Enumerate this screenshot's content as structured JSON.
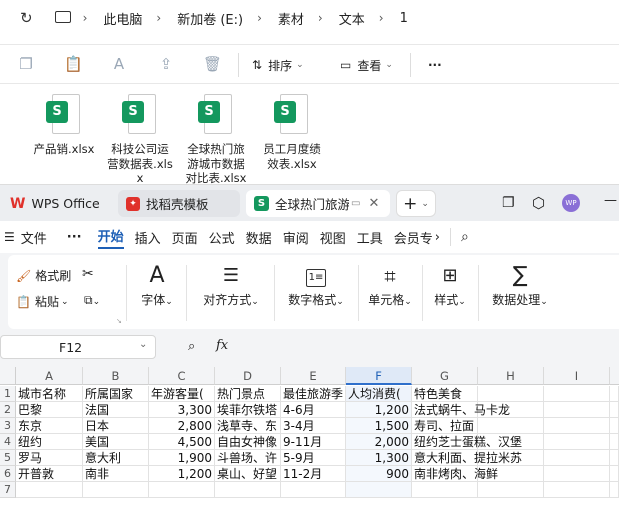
{
  "explorer": {
    "breadcrumb": [
      "此电脑",
      "新加卷 (E:)",
      "素材",
      "文本",
      "1"
    ],
    "toolbar": {
      "sort_label": "排序",
      "view_label": "查看",
      "more_label": "···"
    },
    "files": [
      {
        "name": "产品销.xlsx"
      },
      {
        "name": "科技公司运营数据表.xlsx"
      },
      {
        "name": "全球热门旅游城市数据对比表.xlsx"
      },
      {
        "name": "员工月度绩效表.xlsx"
      }
    ]
  },
  "wps": {
    "tabs": [
      {
        "label": "WPS Office"
      },
      {
        "label": "找稻壳模板"
      },
      {
        "label": "全球热门旅游"
      }
    ],
    "avatar_text": "WP",
    "menu": {
      "file_label": "文件",
      "more_label": "···",
      "items": [
        "开始",
        "插入",
        "页面",
        "公式",
        "数据",
        "审阅",
        "视图",
        "工具",
        "会员专"
      ],
      "active": "开始"
    },
    "ribbon": {
      "format_painter": "格式刷",
      "paste": "粘贴",
      "groups": [
        "字体",
        "对齐方式",
        "数字格式",
        "单元格",
        "样式",
        "数据处理"
      ]
    },
    "formula_bar": {
      "cell_ref": "F12",
      "fx_label": "fx",
      "content": ""
    },
    "sheet": {
      "columns": [
        "A",
        "B",
        "C",
        "D",
        "E",
        "F",
        "G",
        "H",
        "I"
      ],
      "selected_column": "F",
      "row_numbers": [
        "1",
        "2",
        "3",
        "4",
        "5",
        "6",
        "7"
      ],
      "rows": [
        [
          "城市名称",
          "所属国家",
          "年游客量(",
          "热门景点",
          "最佳旅游季",
          "人均消费(",
          "特色美食",
          "",
          ""
        ],
        [
          "巴黎",
          "法国",
          "3,300",
          "埃菲尔铁塔",
          "4-6月",
          "1,200",
          "法式蜗牛、马卡龙",
          "",
          ""
        ],
        [
          "东京",
          "日本",
          "2,800",
          "浅草寺、东",
          "3-4月",
          "1,500",
          "寿司、拉面",
          "",
          ""
        ],
        [
          "纽约",
          "美国",
          "4,500",
          "自由女神像",
          "9-11月",
          "2,000",
          "纽约芝士蛋糕、汉堡",
          "",
          ""
        ],
        [
          "罗马",
          "意大利",
          "1,900",
          "斗兽场、许",
          "5-9月",
          "1,300",
          "意大利面、提拉米苏",
          "",
          ""
        ],
        [
          "开普敦",
          "南非",
          "1,200",
          "桌山、好望",
          "11-2月",
          "900",
          "南非烤肉、海鲜",
          "",
          ""
        ]
      ]
    }
  },
  "colors": {
    "excel_green": "#14985e",
    "accent_blue": "#2f6fcb",
    "wps_red": "#e0312b"
  }
}
